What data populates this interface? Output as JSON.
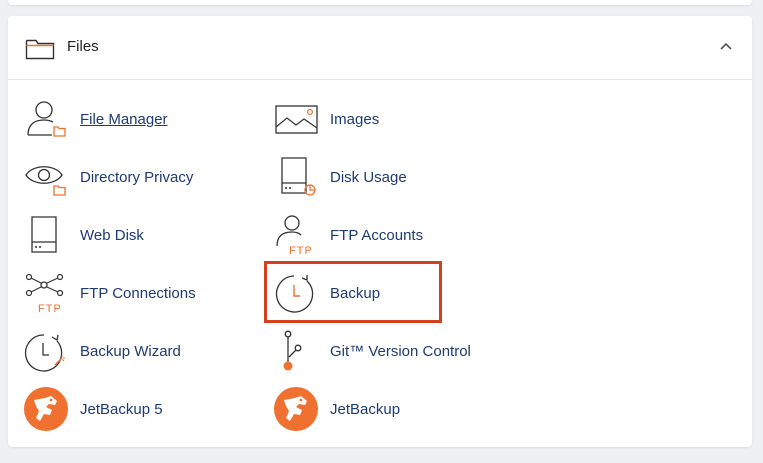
{
  "section": {
    "title": "Files",
    "icon": "folder-icon",
    "collapse_icon": "chevron-up-icon"
  },
  "items": [
    {
      "label": "File Manager",
      "icon": "file-manager-icon",
      "underlined": true
    },
    {
      "label": "Images",
      "icon": "images-icon"
    },
    {
      "label": "Directory Privacy",
      "icon": "directory-privacy-icon"
    },
    {
      "label": "Disk Usage",
      "icon": "disk-usage-icon"
    },
    {
      "label": "Web Disk",
      "icon": "web-disk-icon"
    },
    {
      "label": "FTP Accounts",
      "icon": "ftp-accounts-icon"
    },
    {
      "label": "FTP Connections",
      "icon": "ftp-connections-icon"
    },
    {
      "label": "Backup",
      "icon": "backup-icon",
      "highlighted": true
    },
    {
      "label": "Backup Wizard",
      "icon": "backup-wizard-icon"
    },
    {
      "label": "Git™ Version Control",
      "icon": "git-icon"
    },
    {
      "label": "JetBackup 5",
      "icon": "jetbackup-icon"
    },
    {
      "label": "JetBackup",
      "icon": "jetbackup-icon"
    }
  ],
  "icon_text": {
    "ftp": "FTP"
  },
  "colors": {
    "accent": "#f0712f",
    "link": "#1e3a74",
    "highlight": "#d63f1e",
    "icon_stroke": "#333333"
  }
}
